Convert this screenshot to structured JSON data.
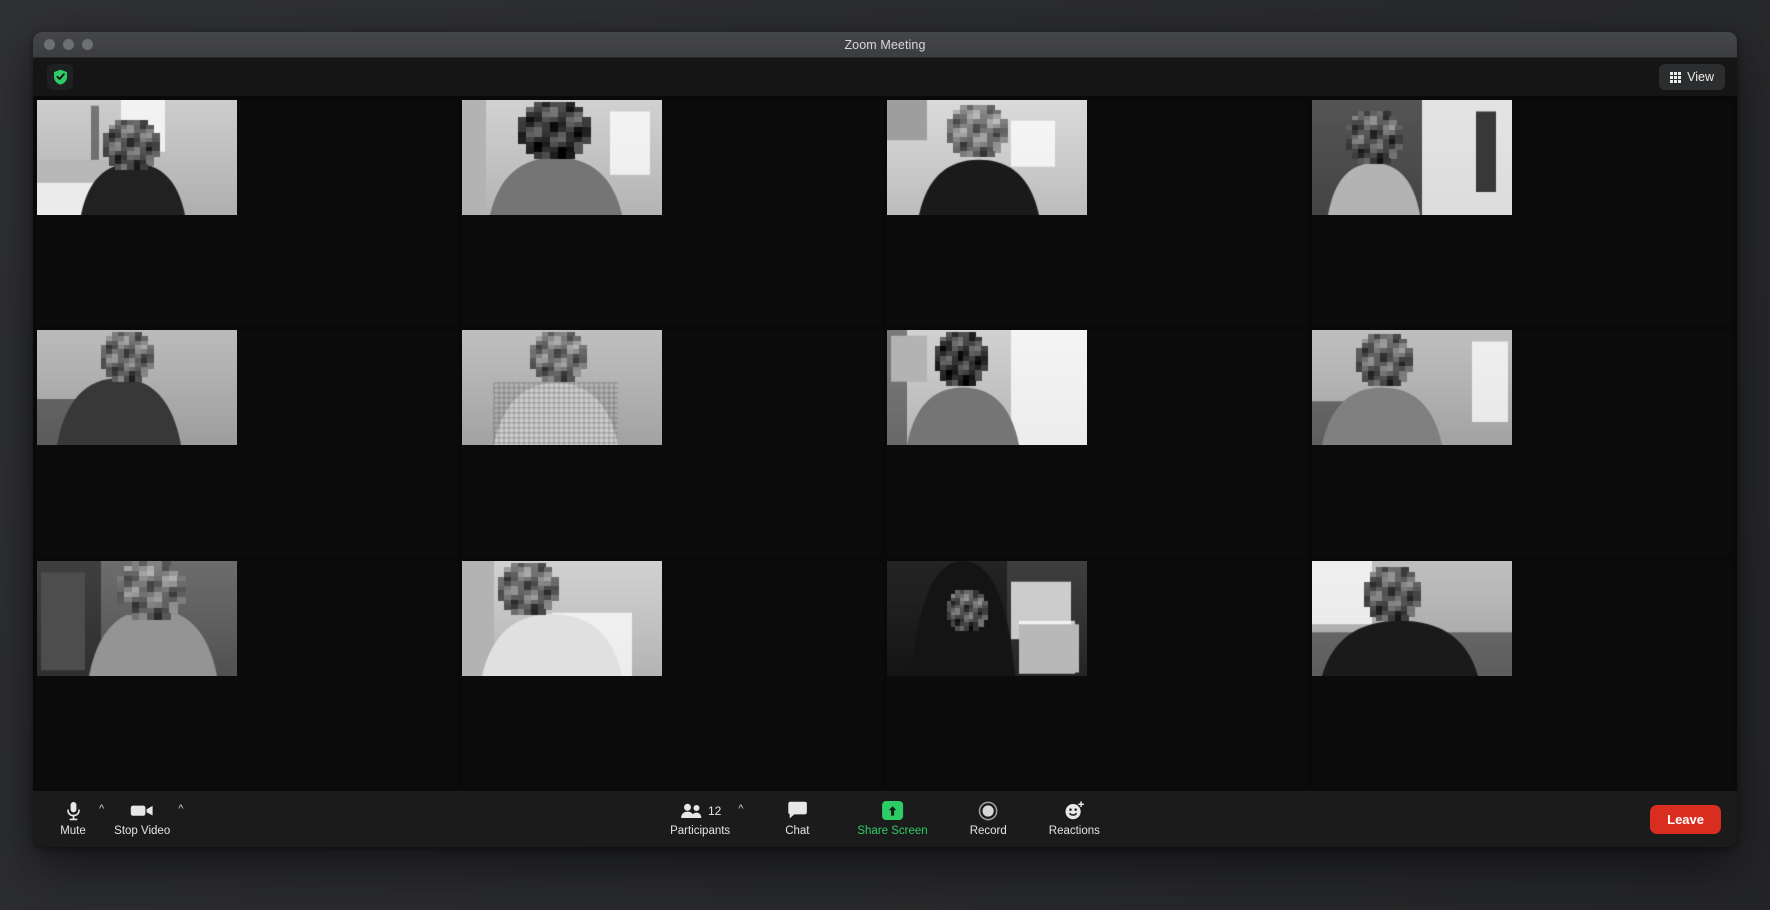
{
  "window": {
    "title": "Zoom Meeting",
    "traffic_lights": [
      "close",
      "minimize",
      "maximize"
    ]
  },
  "header": {
    "encryption_icon": "shield-check-icon",
    "encryption_color": "#2ecc66",
    "view_button": {
      "label": "View",
      "icon": "grid-icon"
    }
  },
  "gallery": {
    "layout": "gallery-grid",
    "columns": 4,
    "rows": 3,
    "tile_count": 12,
    "tiles": [
      {
        "id": 1,
        "position": "row1-col1",
        "scene": "bedroom-with-bed-and-door",
        "face_blurred": true
      },
      {
        "id": 2,
        "position": "row1-col2",
        "scene": "person-in-grey-tshirt-by-window",
        "face_blurred": true
      },
      {
        "id": 3,
        "position": "row1-col3",
        "scene": "person-in-attic-room-with-window",
        "face_blurred": true
      },
      {
        "id": 4,
        "position": "row1-col4",
        "scene": "person-in-hallway-with-railing",
        "face_blurred": true
      },
      {
        "id": 5,
        "position": "row2-col1",
        "scene": "person-with-long-dark-hair",
        "face_blurred": true
      },
      {
        "id": 6,
        "position": "row2-col2",
        "scene": "person-in-checked-shirt",
        "face_blurred": true
      },
      {
        "id": 7,
        "position": "row2-col3",
        "scene": "person-by-bright-window-blinds",
        "face_blurred": true
      },
      {
        "id": 8,
        "position": "row2-col4",
        "scene": "person-near-white-door",
        "face_blurred": true
      },
      {
        "id": 9,
        "position": "row3-col1",
        "scene": "person-in-dim-room-with-door",
        "face_blurred": true
      },
      {
        "id": 10,
        "position": "row3-col2",
        "scene": "person-in-white-top-by-door",
        "face_blurred": true
      },
      {
        "id": 11,
        "position": "row3-col3",
        "scene": "person-in-dark-room-by-radiator",
        "face_blurred": true
      },
      {
        "id": 12,
        "position": "row3-col4",
        "scene": "person-in-dark-top-bright-wall",
        "face_blurred": true
      }
    ]
  },
  "toolbar": {
    "mute": {
      "label": "Mute",
      "icon": "microphone-icon",
      "has_menu": true
    },
    "video": {
      "label": "Stop Video",
      "icon": "camera-icon",
      "has_menu": true
    },
    "participants": {
      "label": "Participants",
      "icon": "participants-icon",
      "count": "12",
      "has_menu": true
    },
    "chat": {
      "label": "Chat",
      "icon": "chat-bubble-icon"
    },
    "share_screen": {
      "label": "Share Screen",
      "icon": "share-screen-icon",
      "color": "#2ecc66"
    },
    "record": {
      "label": "Record",
      "icon": "record-circle-icon"
    },
    "reactions": {
      "label": "Reactions",
      "icon": "reactions-smiley-icon"
    },
    "leave": {
      "label": "Leave",
      "color": "#d92d20"
    }
  }
}
